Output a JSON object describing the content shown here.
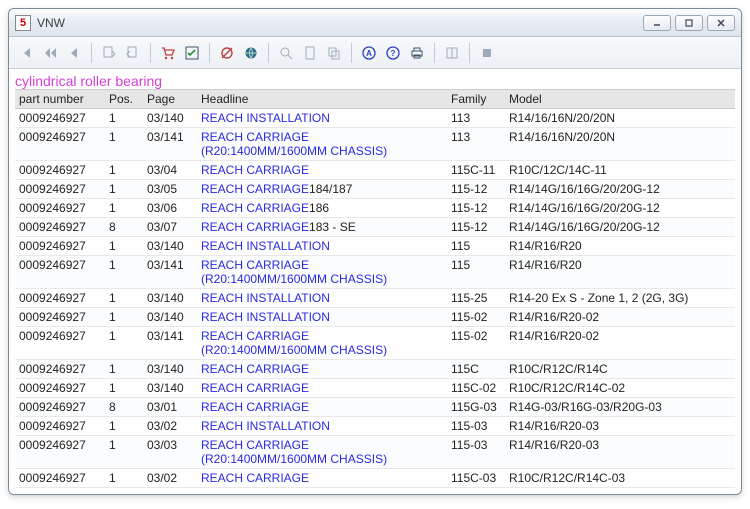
{
  "window": {
    "title": "VNW",
    "app_icon": "5"
  },
  "toolbar": {
    "first": "first",
    "fastback": "fast-back",
    "back": "back",
    "export1": "export",
    "export2": "export2",
    "cart": "cart",
    "check": "checklist",
    "nored": "hide-red",
    "globe": "globe",
    "zoom": "zoom",
    "page": "page",
    "copy": "copy",
    "circleA": "annotate",
    "circleQ": "question",
    "print": "print",
    "book": "book",
    "stop": "stop"
  },
  "heading": "cylindrical roller bearing",
  "columns": {
    "part": "part number",
    "pos": "Pos.",
    "page": "Page",
    "headline": "Headline",
    "family": "Family",
    "model": "Model"
  },
  "rows": [
    {
      "part": "0009246927",
      "pos": "1",
      "page": "03/140",
      "headline": "REACH INSTALLATION",
      "suffix": "",
      "sub": "",
      "family": "113",
      "model": "R14/16/16N/20/20N"
    },
    {
      "part": "0009246927",
      "pos": "1",
      "page": "03/141",
      "headline": "REACH CARRIAGE",
      "suffix": "",
      "sub": "(R20:1400MM/1600MM CHASSIS)",
      "family": "113",
      "model": "R14/16/16N/20/20N"
    },
    {
      "part": "0009246927",
      "pos": "1",
      "page": "03/04",
      "headline": "REACH CARRIAGE",
      "suffix": "",
      "sub": "",
      "family": "115C-11",
      "model": "R10C/12C/14C-11"
    },
    {
      "part": "0009246927",
      "pos": "1",
      "page": "03/05",
      "headline": "REACH CARRIAGE",
      "suffix": "184/187",
      "sub": "",
      "family": "115-12",
      "model": "R14/14G/16/16G/20/20G-12"
    },
    {
      "part": "0009246927",
      "pos": "1",
      "page": "03/06",
      "headline": "REACH CARRIAGE",
      "suffix": "186",
      "sub": "",
      "family": "115-12",
      "model": "R14/14G/16/16G/20/20G-12"
    },
    {
      "part": "0009246927",
      "pos": "8",
      "page": "03/07",
      "headline": "REACH CARRIAGE",
      "suffix": "183 - SE",
      "sub": "",
      "family": "115-12",
      "model": "R14/14G/16/16G/20/20G-12"
    },
    {
      "part": "0009246927",
      "pos": "1",
      "page": "03/140",
      "headline": "REACH INSTALLATION",
      "suffix": "",
      "sub": "",
      "family": "115",
      "model": "R14/R16/R20"
    },
    {
      "part": "0009246927",
      "pos": "1",
      "page": "03/141",
      "headline": "REACH CARRIAGE",
      "suffix": "",
      "sub": "(R20:1400MM/1600MM CHASSIS)",
      "family": "115",
      "model": "R14/R16/R20"
    },
    {
      "part": "0009246927",
      "pos": "1",
      "page": "03/140",
      "headline": "REACH INSTALLATION",
      "suffix": "",
      "sub": "",
      "family": "115-25",
      "model": "R14-20 Ex S - Zone 1, 2 (2G, 3G)"
    },
    {
      "part": "0009246927",
      "pos": "1",
      "page": "03/140",
      "headline": "REACH INSTALLATION",
      "suffix": "",
      "sub": "",
      "family": "115-02",
      "model": "R14/R16/R20-02"
    },
    {
      "part": "0009246927",
      "pos": "1",
      "page": "03/141",
      "headline": "REACH CARRIAGE",
      "suffix": "",
      "sub": "(R20:1400MM/1600MM CHASSIS)",
      "family": "115-02",
      "model": "R14/R16/R20-02"
    },
    {
      "part": "0009246927",
      "pos": "1",
      "page": "03/140",
      "headline": "REACH CARRIAGE",
      "suffix": "",
      "sub": "",
      "family": "115C",
      "model": "R10C/R12C/R14C"
    },
    {
      "part": "0009246927",
      "pos": "1",
      "page": "03/140",
      "headline": "REACH CARRIAGE",
      "suffix": "",
      "sub": "",
      "family": "115C-02",
      "model": "R10C/R12C/R14C-02"
    },
    {
      "part": "0009246927",
      "pos": "8",
      "page": "03/01",
      "headline": "REACH CARRIAGE",
      "suffix": "",
      "sub": "",
      "family": "115G-03",
      "model": "R14G-03/R16G-03/R20G-03"
    },
    {
      "part": "0009246927",
      "pos": "1",
      "page": "03/02",
      "headline": "REACH INSTALLATION",
      "suffix": "",
      "sub": "",
      "family": "115-03",
      "model": "R14/R16/R20-03"
    },
    {
      "part": "0009246927",
      "pos": "1",
      "page": "03/03",
      "headline": "REACH CARRIAGE",
      "suffix": "",
      "sub": "(R20:1400MM/1600MM CHASSIS)",
      "family": "115-03",
      "model": "R14/R16/R20-03"
    },
    {
      "part": "0009246927",
      "pos": "1",
      "page": "03/02",
      "headline": "REACH CARRIAGE",
      "suffix": "",
      "sub": "",
      "family": "115C-03",
      "model": "R10C/R12C/R14C-03"
    }
  ]
}
